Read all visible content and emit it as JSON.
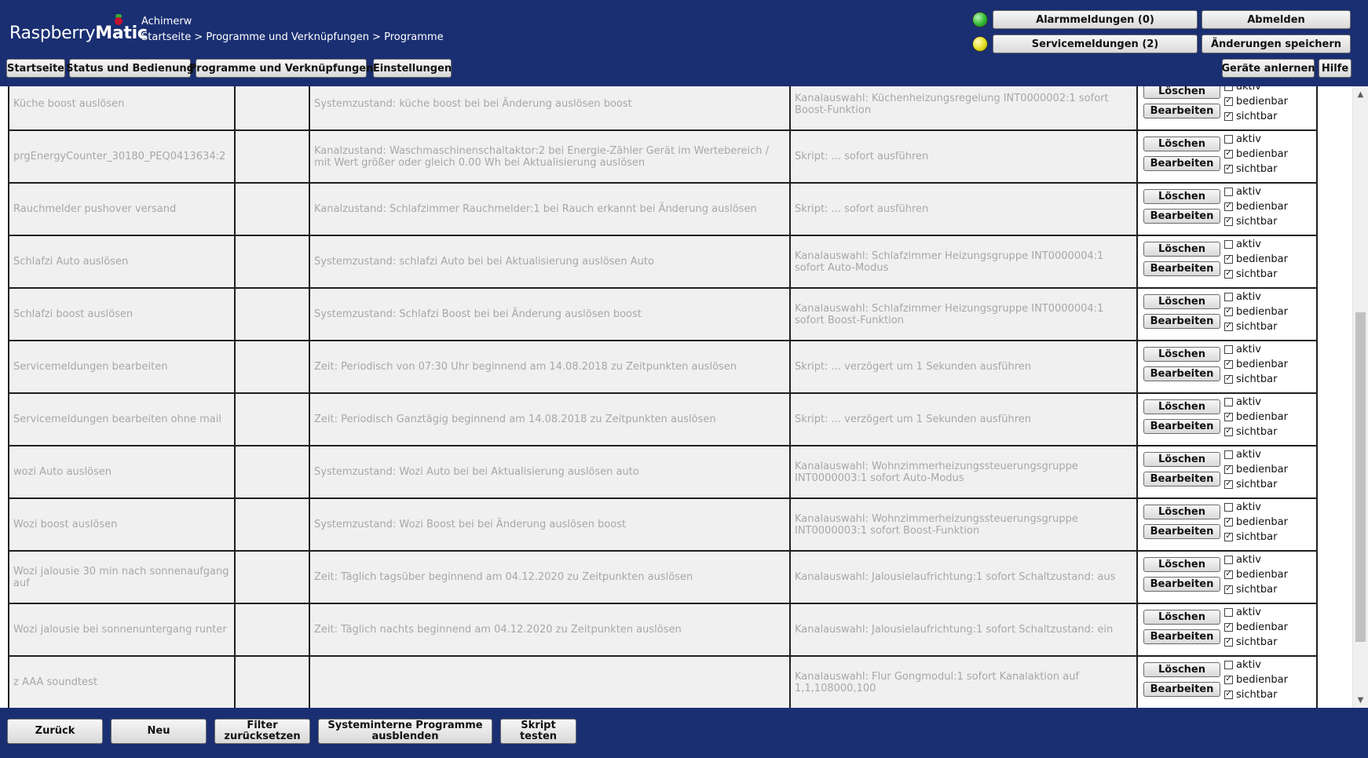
{
  "app": {
    "logo_light": "Raspberry",
    "logo_bold": "Matic",
    "user": "Achimerw",
    "breadcrumb": "Startseite > Programme und Verknüpfungen > Programme"
  },
  "header": {
    "alarm_label": "Alarmmeldungen (0)",
    "service_label": "Servicemeldungen (2)",
    "logout_label": "Abmelden",
    "save_label": "Änderungen speichern",
    "teach_label": "Geräte anlernen",
    "help_label": "Hilfe",
    "nav": [
      "Startseite",
      "Status und Bedienung",
      "Programme und Verknüpfungen",
      "Einstellungen"
    ],
    "led_alarm_color": "#2fb82f",
    "led_service_color": "#e6de1e"
  },
  "row_buttons": {
    "delete": "Löschen",
    "edit": "Bearbeiten"
  },
  "row_options": [
    "aktiv",
    "bedienbar",
    "sichtbar"
  ],
  "programs": [
    {
      "name": "Küche boost auslösen",
      "condition": "Systemzustand: küche boost bei bei Änderung auslösen boost",
      "action": "Kanalauswahl: Küchenheizungsregelung INT0000002:1 sofort Boost-Funktion",
      "aktiv": false,
      "bedienbar": true,
      "sichtbar": true
    },
    {
      "name": "prgEnergyCounter_30180_PEQ0413634:2",
      "condition": "Kanalzustand: Waschmaschinenschaltaktor:2 bei Energie-Zähler Gerät im Wertebereich / mit Wert größer oder gleich 0.00 Wh bei Aktualisierung auslösen",
      "action": "Skript: ... sofort ausführen",
      "aktiv": false,
      "bedienbar": true,
      "sichtbar": true
    },
    {
      "name": "Rauchmelder pushover versand",
      "condition": "Kanalzustand: Schlafzimmer Rauchmelder:1 bei Rauch erkannt bei Änderung auslösen",
      "action": "Skript: ... sofort ausführen",
      "aktiv": false,
      "bedienbar": true,
      "sichtbar": true
    },
    {
      "name": "Schlafzi Auto auslösen",
      "condition": "Systemzustand: schlafzi Auto bei bei Aktualisierung auslösen Auto",
      "action": "Kanalauswahl: Schlafzimmer Heizungsgruppe INT0000004:1 sofort Auto-Modus",
      "aktiv": false,
      "bedienbar": true,
      "sichtbar": true
    },
    {
      "name": "Schlafzi boost auslösen",
      "condition": "Systemzustand: Schlafzi Boost bei bei Änderung auslösen boost",
      "action": "Kanalauswahl: Schlafzimmer Heizungsgruppe INT0000004:1 sofort Boost-Funktion",
      "aktiv": false,
      "bedienbar": true,
      "sichtbar": true
    },
    {
      "name": "Servicemeldungen bearbeiten",
      "condition": "Zeit: Periodisch von 07:30 Uhr beginnend am 14.08.2018 zu Zeitpunkten auslösen",
      "action": "Skript: ... verzögert um 1 Sekunden ausführen",
      "aktiv": false,
      "bedienbar": true,
      "sichtbar": true
    },
    {
      "name": "Servicemeldungen bearbeiten ohne mail",
      "condition": "Zeit: Periodisch Ganztägig beginnend am 14.08.2018 zu Zeitpunkten auslösen",
      "action": "Skript: ... verzögert um 1 Sekunden ausführen",
      "aktiv": false,
      "bedienbar": true,
      "sichtbar": true
    },
    {
      "name": "wozi Auto auslösen",
      "condition": "Systemzustand: Wozi Auto bei bei Aktualisierung auslösen auto",
      "action": "Kanalauswahl: Wohnzimmerheizungssteuerungsgruppe INT0000003:1 sofort Auto-Modus",
      "aktiv": false,
      "bedienbar": true,
      "sichtbar": true
    },
    {
      "name": "Wozi boost auslösen",
      "condition": "Systemzustand: Wozi Boost bei bei Änderung auslösen boost",
      "action": "Kanalauswahl: Wohnzimmerheizungssteuerungsgruppe INT0000003:1 sofort Boost-Funktion",
      "aktiv": false,
      "bedienbar": true,
      "sichtbar": true
    },
    {
      "name": "Wozi jalousie 30 min nach sonnenaufgang auf",
      "condition": "Zeit: Täglich tagsüber beginnend am 04.12.2020 zu Zeitpunkten auslösen",
      "action": "Kanalauswahl: Jalousielaufrichtung:1 sofort Schaltzustand: aus",
      "aktiv": false,
      "bedienbar": true,
      "sichtbar": true
    },
    {
      "name": "Wozi jalousie bei sonnenuntergang runter",
      "condition": "Zeit: Täglich nachts beginnend am 04.12.2020 zu Zeitpunkten auslösen",
      "action": "Kanalauswahl: Jalousielaufrichtung:1 sofort Schaltzustand: ein",
      "aktiv": false,
      "bedienbar": true,
      "sichtbar": true
    },
    {
      "name": "z AAA soundtest",
      "condition": "",
      "action": "Kanalauswahl: Flur Gongmodul:1 sofort Kanalaktion auf 1,1,108000,100",
      "aktiv": false,
      "bedienbar": true,
      "sichtbar": true
    }
  ],
  "scroll_position": 0.87,
  "footer": {
    "back": "Zurück",
    "new": "Neu",
    "reset_filter": "Filter zurücksetzen",
    "hide_system": "Systeminterne Programme ausblenden",
    "test_script": "Skript testen"
  }
}
